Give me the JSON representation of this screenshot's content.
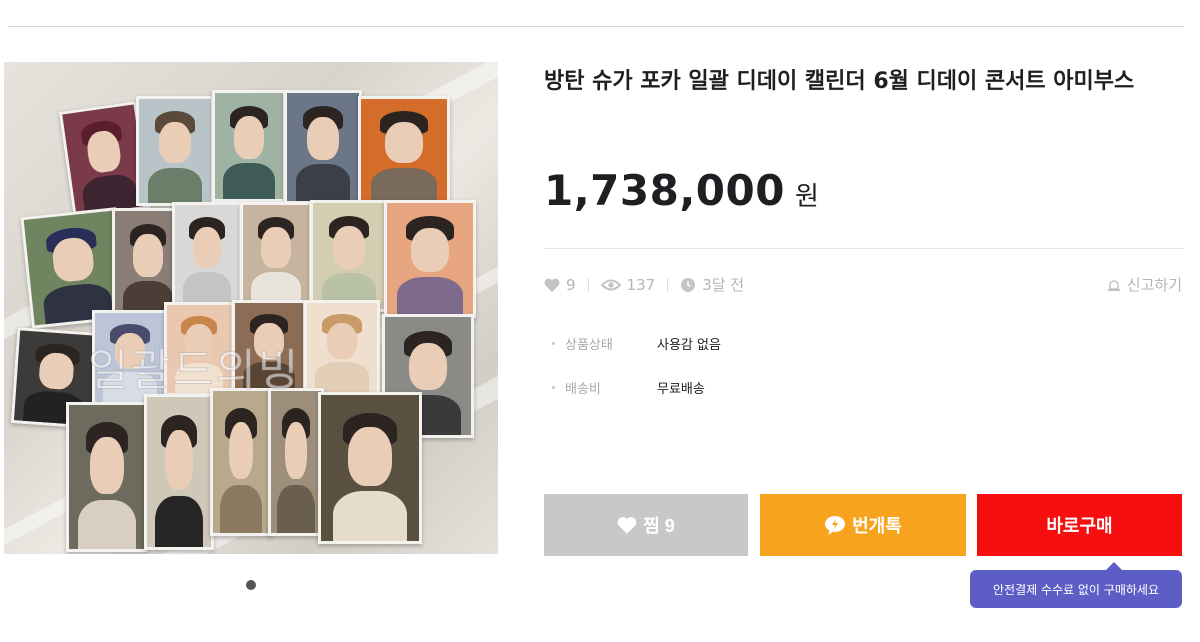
{
  "product": {
    "title": "방탄 슈가 포카 일괄 디데이 캘린더 6월 디데이 콘서트 아미부스",
    "price": "1,738,000",
    "price_unit": "원",
    "image_watermark": "일괄드의빙"
  },
  "gallery": {
    "page_indicator_count": 1
  },
  "stats": {
    "likes": "9",
    "views": "137",
    "time": "3달 전",
    "report_label": "신고하기"
  },
  "info": [
    {
      "key": "상품상태",
      "value": "사용감 없음"
    },
    {
      "key": "배송비",
      "value": "무료배송"
    }
  ],
  "actions": {
    "like_label": "찜 9",
    "chat_label": "번개톡",
    "buy_label": "바로구매",
    "buy_tooltip": "안전결제 수수료 없이 구매하세요"
  },
  "colors": {
    "like_button": "#c8c8c8",
    "chat_button": "#f8a31d",
    "buy_button": "#f70f0f",
    "tooltip": "#5d5ec5"
  }
}
